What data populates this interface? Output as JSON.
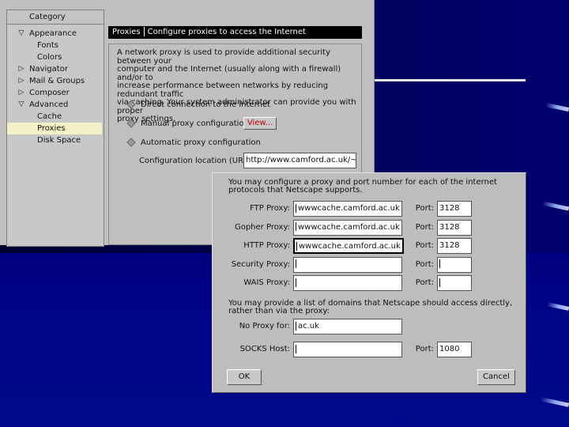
{
  "main_window": {
    "category_header": "Category",
    "tree": [
      {
        "label": "Appearance",
        "twisty": "▽",
        "indent": 0,
        "selected": false
      },
      {
        "label": "Fonts",
        "twisty": "",
        "indent": 1,
        "selected": false
      },
      {
        "label": "Colors",
        "twisty": "",
        "indent": 1,
        "selected": false
      },
      {
        "label": "Navigator",
        "twisty": "▷",
        "indent": 0,
        "selected": false
      },
      {
        "label": "Mail & Groups",
        "twisty": "▷",
        "indent": 0,
        "selected": false
      },
      {
        "label": "Composer",
        "twisty": "▷",
        "indent": 0,
        "selected": false
      },
      {
        "label": "Advanced",
        "twisty": "▽",
        "indent": 0,
        "selected": false
      },
      {
        "label": "Cache",
        "twisty": "",
        "indent": 1,
        "selected": false
      },
      {
        "label": "Proxies",
        "twisty": "",
        "indent": 1,
        "selected": true
      },
      {
        "label": "Disk Space",
        "twisty": "",
        "indent": 1,
        "selected": false
      }
    ],
    "panel_title": "Proxies",
    "panel_subtitle": "Configure proxies to access the Internet",
    "description": "A network proxy is used to provide additional security between your\ncomputer and the Internet (usually along with a firewall) and/or to\nincrease performance between networks by reducing redundant traffic\nvia caching. Your system administrator can provide you with proper\nproxy settings.",
    "options": {
      "direct": "Direct connection to the Internet",
      "manual": "Manual proxy configuration",
      "automatic": "Automatic proxy configuration"
    },
    "view_button": "View...",
    "config_location_label": "Configuration location (URL)",
    "config_location_value": "http://www.camford.ac.uk/~j.pac"
  },
  "proxy_dialog": {
    "description": "You may configure a proxy and port number for each of the internet\nprotocols that Netscape supports.",
    "rows": [
      {
        "label": "FTP Proxy:",
        "host": "wwwcache.camford.ac.uk",
        "port": "3128"
      },
      {
        "label": "Gopher Proxy:",
        "host": "wwwcache.camford.ac.uk",
        "port": "3128"
      },
      {
        "label": "HTTP Proxy:",
        "host": "wwwcache.camford.ac.uk",
        "port": "3128"
      },
      {
        "label": "Security Proxy:",
        "host": "",
        "port": ""
      },
      {
        "label": "WAIS Proxy:",
        "host": "",
        "port": ""
      }
    ],
    "port_label": "Port:",
    "no_proxy_description": "You may provide a list of domains that Netscape should access directly,\nrather than via the proxy:",
    "no_proxy_label": "No Proxy for:",
    "no_proxy_value": "ac.uk",
    "socks_label": "SOCKS Host:",
    "socks_host": "",
    "socks_port": "1080",
    "ok_button": "OK",
    "cancel_button": "Cancel"
  },
  "colors": {
    "slide_background": "#000080",
    "window_gray": "#c0c0c0",
    "selected_row": "#f4f1c6",
    "view_button_text": "#c00000"
  }
}
